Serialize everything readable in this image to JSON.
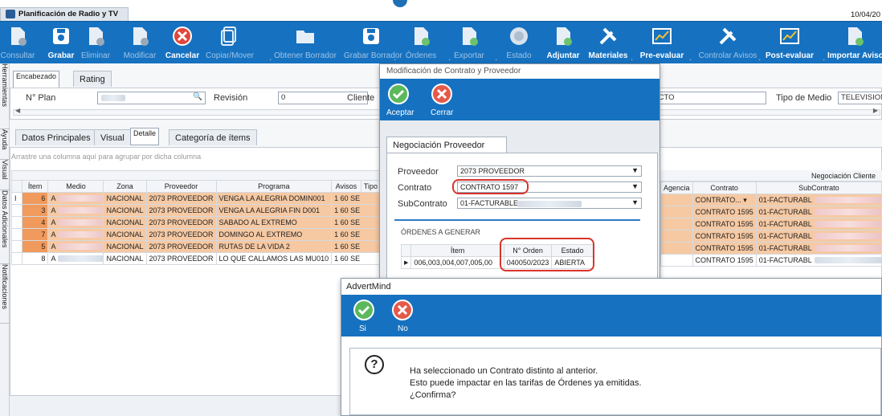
{
  "app": {
    "tab_title": "Planificación de Radio y TV",
    "date": "10/04/20"
  },
  "toolbar": {
    "items": [
      {
        "label": "Consultar",
        "icon": "consult-doc-icon",
        "enabled": false
      },
      {
        "label": "Grabar",
        "icon": "save-icon",
        "enabled": true
      },
      {
        "label": "Eliminar",
        "icon": "delete-doc-icon",
        "enabled": false
      },
      {
        "label": "Modificar",
        "icon": "edit-doc-icon",
        "enabled": false
      },
      {
        "label": "Cancelar",
        "icon": "cancel-icon",
        "enabled": true
      },
      {
        "label": "Copiar/Mover",
        "icon": "copy-icon",
        "enabled": false
      },
      {
        "label": "Obtener Borrador",
        "icon": "folder-icon",
        "enabled": false
      },
      {
        "label": "Grabar Borrador",
        "icon": "save-draft-icon",
        "enabled": false
      },
      {
        "label": "Órdenes",
        "icon": "orders-icon",
        "enabled": false
      },
      {
        "label": "Exportar",
        "icon": "export-icon",
        "enabled": false
      },
      {
        "label": "Estado",
        "icon": "status-icon",
        "enabled": false
      },
      {
        "label": "Adjuntar",
        "icon": "attach-icon",
        "enabled": true
      },
      {
        "label": "Materiales",
        "icon": "tools-icon",
        "enabled": true
      },
      {
        "label": "Pre-evaluar",
        "icon": "chart-icon",
        "enabled": true
      },
      {
        "label": "Controlar Avisos",
        "icon": "tools-icon",
        "enabled": false
      },
      {
        "label": "Post-evaluar",
        "icon": "chart-icon",
        "enabled": true
      },
      {
        "label": "Importar Avisos",
        "icon": "import-icon",
        "enabled": true
      }
    ]
  },
  "vtabs": [
    "Herramientas",
    "Ayuda",
    "Visual",
    "Datos Adicionales",
    "Notificaciones"
  ],
  "header": {
    "tabs": [
      "Encabezado",
      "Rating"
    ],
    "plan_label": "N° Plan",
    "revision_label": "Revisión",
    "revision_value": "0",
    "client_label": "Cliente",
    "product_fragment": "ICTO",
    "media_type_label": "Tipo de Medio",
    "media_type_value": "TELEVISION"
  },
  "detail": {
    "tabs": [
      "Datos Principales",
      "Visual",
      "Detalle",
      "Categoría de ítems"
    ],
    "group_hint": "Arrastre una columna aquí para agrupar por dicha columna",
    "columns": [
      "Ítem",
      "Medio",
      "Zona",
      "Proveedor",
      "Programa",
      "Avisos",
      "Tipo"
    ],
    "right_group_header": "Negociación Cliente",
    "right_columns": [
      "Agencia",
      "Contrato",
      "SubContrato"
    ],
    "rows": [
      {
        "item": "6",
        "medio": "A",
        "zona": "NACIONAL",
        "proveedor": "2073 PROVEEDOR",
        "programa": "VENGA LA ALEGRIA DOMIN001",
        "avisos": "1",
        "tipo": "60 SE",
        "contrato": "CONTRATO...",
        "subcontrato": "01-FACTURABL",
        "highlight": true
      },
      {
        "item": "3",
        "medio": "A",
        "zona": "NACIONAL",
        "proveedor": "2073 PROVEEDOR",
        "programa": "VENGA LA ALEGRIA FIN D001",
        "avisos": "1",
        "tipo": "60 SE",
        "contrato": "CONTRATO 1595",
        "subcontrato": "01-FACTURABL",
        "highlight": true
      },
      {
        "item": "4",
        "medio": "A",
        "zona": "NACIONAL",
        "proveedor": "2073 PROVEEDOR",
        "programa": "SABADO AL EXTREMO",
        "avisos": "1",
        "tipo": "60 SE",
        "contrato": "CONTRATO 1595",
        "subcontrato": "01-FACTURABL",
        "highlight": true
      },
      {
        "item": "7",
        "medio": "A",
        "zona": "NACIONAL",
        "proveedor": "2073 PROVEEDOR",
        "programa": "DOMINGO AL EXTREMO",
        "avisos": "1",
        "tipo": "60 SE",
        "contrato": "CONTRATO 1595",
        "subcontrato": "01-FACTURABL",
        "highlight": true
      },
      {
        "item": "5",
        "medio": "A",
        "zona": "NACIONAL",
        "proveedor": "2073 PROVEEDOR",
        "programa": "RUTAS DE LA VIDA 2",
        "avisos": "1",
        "tipo": "60 SE",
        "contrato": "CONTRATO 1595",
        "subcontrato": "01-FACTURABL",
        "highlight": true
      },
      {
        "item": "8",
        "medio": "A",
        "zona": "NACIONAL",
        "proveedor": "2073 PROVEEDOR",
        "programa": "LO QUE CALLAMOS LAS MU010",
        "avisos": "1",
        "tipo": "60 SE",
        "contrato": "CONTRATO 1595",
        "subcontrato": "01-FACTURABL",
        "highlight": false
      }
    ]
  },
  "modal_contract": {
    "title": "Modificación de Contrato y Proveedor",
    "accept_label": "Aceptar",
    "close_label": "Cerrar",
    "tab": "Negociación Proveedor",
    "proveedor_label": "Proveedor",
    "proveedor_value": "2073 PROVEEDOR",
    "contrato_label": "Contrato",
    "contrato_value": "CONTRATO 1597",
    "subcontrato_label": "SubContrato",
    "subcontrato_value": "01-FACTURABLE-",
    "orders_header": "ÓRDENES A GENERAR",
    "orders_columns": [
      "Ítem",
      "N° Orden",
      "Estado"
    ],
    "orders_rows": [
      {
        "items": "006,003,004,007,005,00",
        "orden": "040050/2023",
        "estado": "ABIERTA"
      }
    ]
  },
  "modal_confirm": {
    "title": "AdvertMind",
    "yes_label": "Si",
    "no_label": "No",
    "line1": "Ha seleccionado un Contrato distinto al anterior.",
    "line2": "Esto puede impactar en las tarifas de Órdenes ya emitidas.",
    "line3": "¿Confirma?"
  },
  "colors": {
    "toolbar": "#1672c0",
    "highlight_row": "#f6c9a3",
    "item_cell": "#f09a5d",
    "ring": "#d9342b"
  }
}
